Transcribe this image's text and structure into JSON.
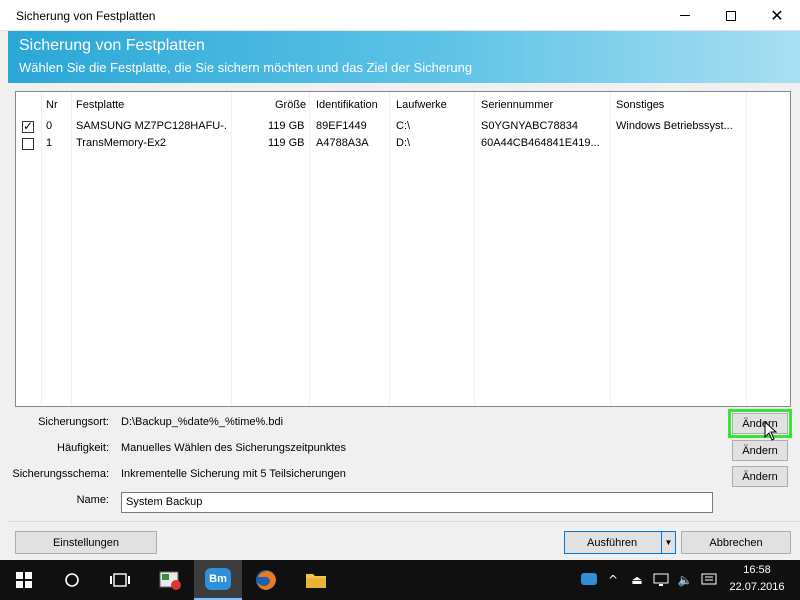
{
  "window": {
    "title": "Sicherung von Festplatten"
  },
  "banner": {
    "title": "Sicherung von Festplatten",
    "subtitle": "Wählen Sie die Festplatte, die Sie sichern möchten und das Ziel der Sicherung"
  },
  "table": {
    "headers": {
      "nr": "Nr",
      "disk": "Festplatte",
      "size": "Größe",
      "id": "Identifikation",
      "drives": "Laufwerke",
      "serial": "Seriennummer",
      "other": "Sonstiges"
    },
    "rows": [
      {
        "checked": true,
        "nr": "0",
        "disk": "SAMSUNG MZ7PC128HAFU-...",
        "size": "119 GB",
        "id": "89EF1449",
        "drives": "C:\\",
        "serial": "S0YGNYABC78834",
        "other": "Windows Betriebssyst..."
      },
      {
        "checked": false,
        "nr": "1",
        "disk": "TransMemory-Ex2",
        "size": "119 GB",
        "id": "A4788A3A",
        "drives": "D:\\",
        "serial": "60A44CB464841E419...",
        "other": ""
      }
    ]
  },
  "settings": {
    "location_label": "Sicherungsort:",
    "location_value": "D:\\Backup_%date%_%time%.bdi",
    "frequency_label": "Häufigkeit:",
    "frequency_value": "Manuelles Wählen des Sicherungszeitpunktes",
    "scheme_label": "Sicherungsschema:",
    "scheme_value": "Inkrementelle Sicherung mit 5 Teilsicherungen",
    "name_label": "Name:",
    "name_value": "System Backup",
    "change_label": "Ändern"
  },
  "footer": {
    "settings_button": "Einstellungen",
    "run_button": "Ausführen",
    "cancel_button": "Abbrechen"
  },
  "taskbar": {
    "time": "16:58",
    "date": "22.07.2016",
    "active_app_label": "Bm"
  },
  "colors": {
    "banner_start": "#2aa7d7",
    "highlight": "#35e635",
    "taskbar": "#101010"
  }
}
